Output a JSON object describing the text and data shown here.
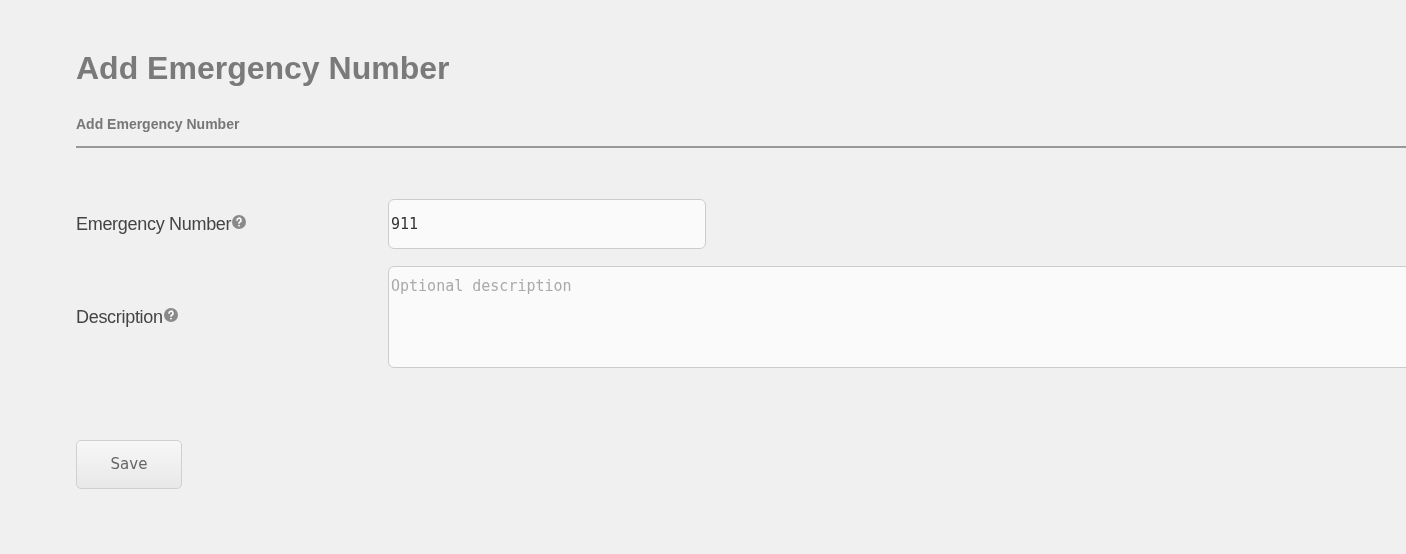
{
  "page_title": "Add Emergency Number",
  "section_title": "Add Emergency Number",
  "fields": [
    {
      "kind": "input",
      "label": "Emergency Number",
      "value": "911"
    },
    {
      "kind": "textarea",
      "label": "Description",
      "placeholder": "Optional description"
    }
  ],
  "buttons": [
    "Save"
  ]
}
